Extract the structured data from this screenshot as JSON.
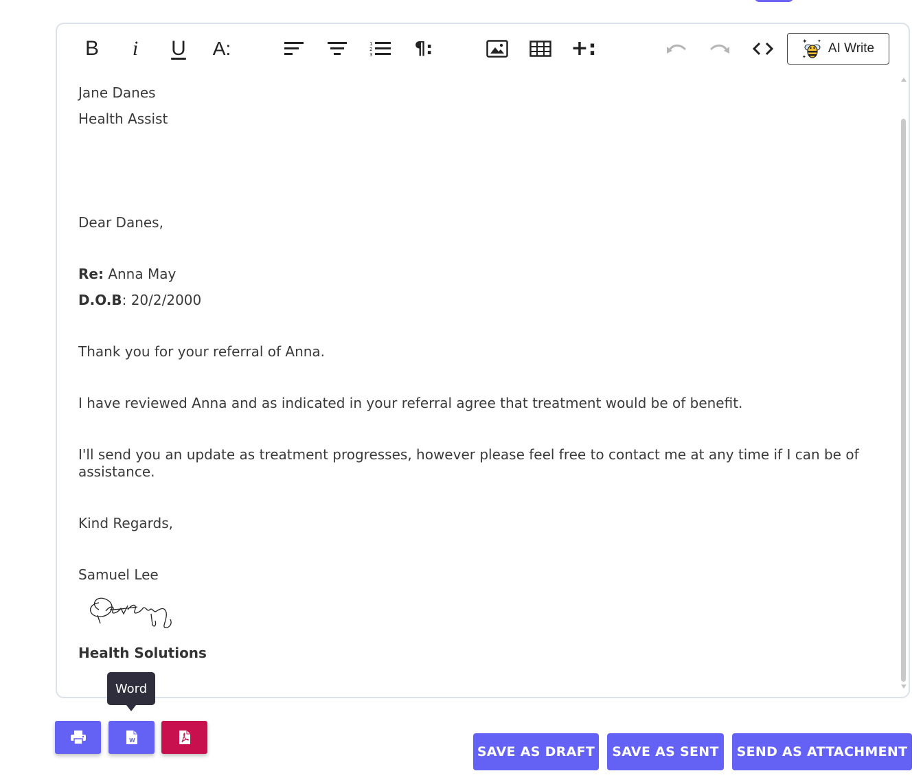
{
  "toolbar": {
    "items": [
      {
        "name": "bold",
        "glyph": "B"
      },
      {
        "name": "italic",
        "glyph": "i"
      },
      {
        "name": "underline",
        "glyph": "U"
      },
      {
        "name": "font-size",
        "glyph": "A:"
      }
    ],
    "ai_write_label": "AI Write"
  },
  "letter": {
    "recipient_name": "Jane Danes",
    "recipient_org": "Health Assist",
    "salutation": "Dear Danes,",
    "re_label": "Re:",
    "re_value": " Anna May",
    "dob_label": "D.O.B",
    "dob_value": ": 20/2/2000",
    "para1": "Thank you for your referral of Anna.",
    "para2": "I have reviewed Anna and as indicated in your referral agree that treatment would be of benefit.",
    "para3": "I'll send you an update as treatment progresses, however please feel free to contact me at any time if I can be of assistance.",
    "closing": "Kind Regards,",
    "signer_name": "Samuel Lee",
    "signer_org": "Health Solutions"
  },
  "export": {
    "tooltip": "Word",
    "print_color": "#6461f5",
    "word_color": "#6461f5",
    "pdf_color": "#c8104e"
  },
  "actions": {
    "save_draft": "SAVE AS DRAFT",
    "save_sent": "SAVE AS SENT",
    "send_attachment": "SEND AS ATTACHMENT"
  }
}
